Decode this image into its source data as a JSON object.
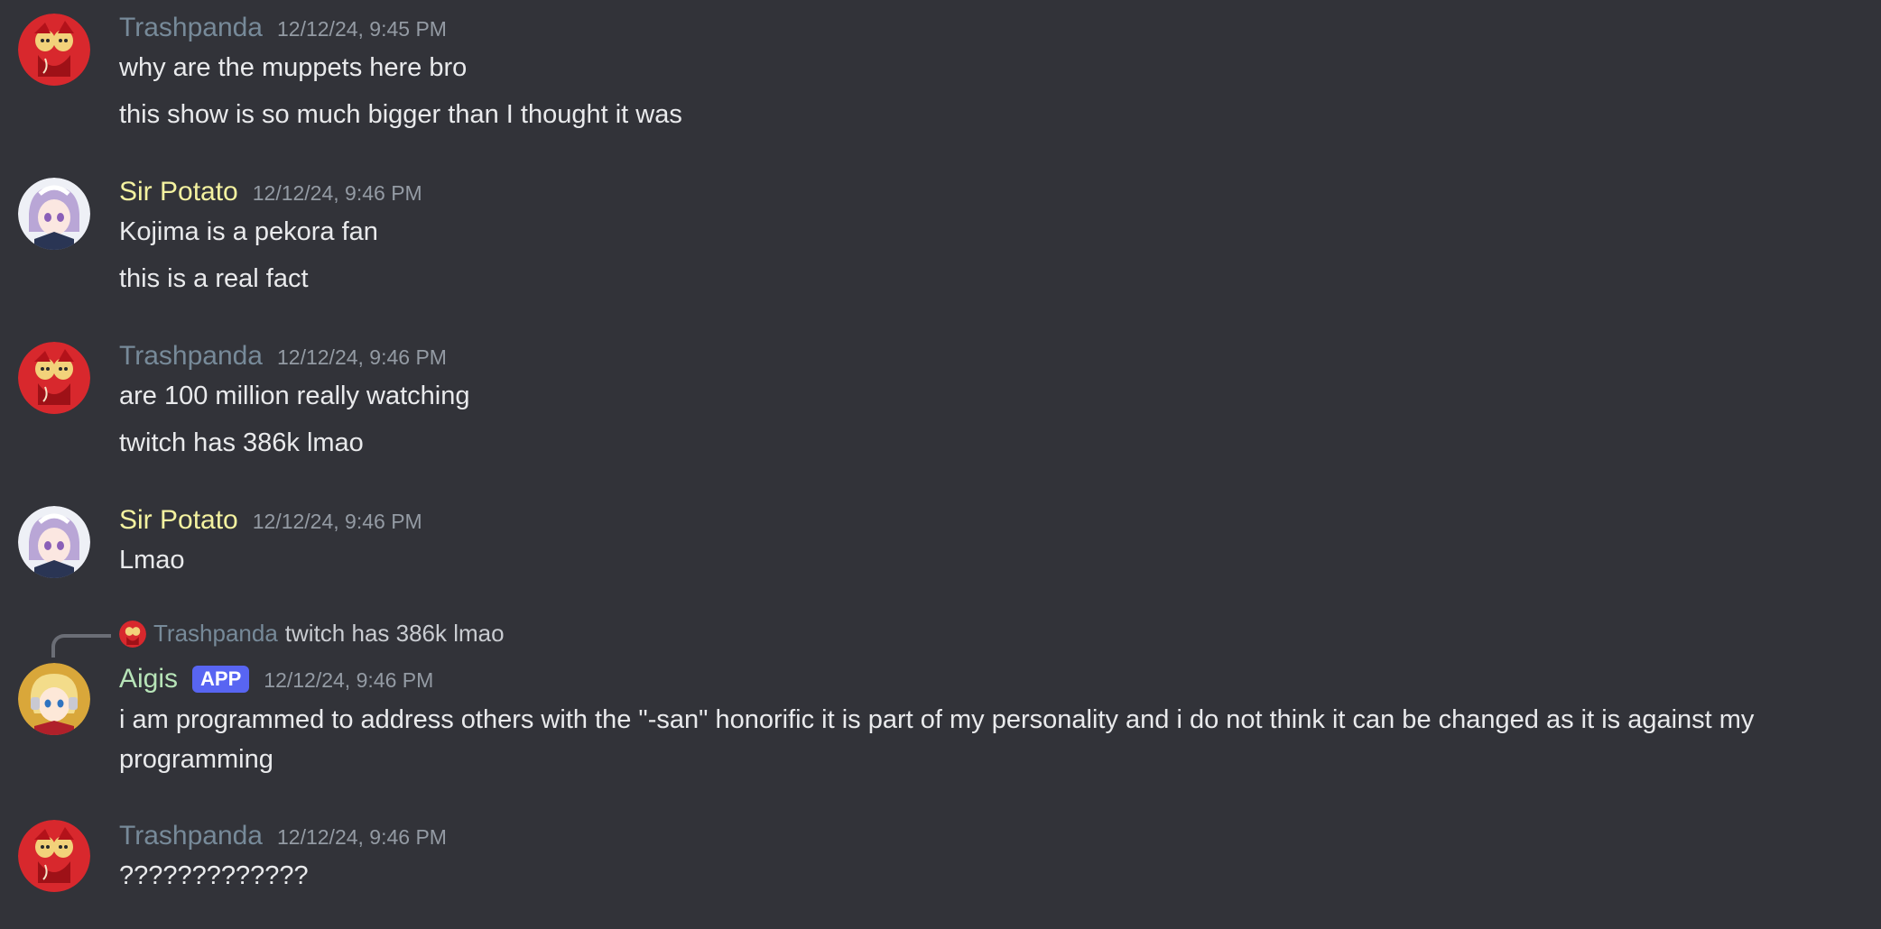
{
  "colors": {
    "background": "#323339",
    "trashpanda_name": "#778a99",
    "sir_potato_name": "#f4f2a0",
    "aigis_name": "#b7e4b8",
    "app_badge": "#5865f2",
    "timestamp": "#949ba4"
  },
  "messages": [
    {
      "author": "Trashpanda",
      "timestamp": "12/12/24, 9:45 PM",
      "avatar_icon": "trashpanda-avatar",
      "lines": [
        "why are the muppets here bro",
        "this show is so much bigger than I thought it was"
      ]
    },
    {
      "author": "Sir Potato",
      "timestamp": "12/12/24, 9:46 PM",
      "avatar_icon": "sir-potato-avatar",
      "lines": [
        "Kojima is a pekora fan",
        "this is a real fact"
      ]
    },
    {
      "author": "Trashpanda",
      "timestamp": "12/12/24, 9:46 PM",
      "avatar_icon": "trashpanda-avatar",
      "lines": [
        "are 100 million really watching",
        "twitch has 386k lmao"
      ]
    },
    {
      "author": "Sir Potato",
      "timestamp": "12/12/24, 9:46 PM",
      "avatar_icon": "sir-potato-avatar",
      "lines": [
        "Lmao"
      ]
    },
    {
      "author": "Aigis",
      "badge": "APP",
      "timestamp": "12/12/24, 9:46 PM",
      "avatar_icon": "aigis-avatar",
      "reply": {
        "author": "Trashpanda",
        "text": "twitch has 386k lmao"
      },
      "lines": [
        "i am programmed to address others with the \"-san\" honorific it is part of my personality and i do not think it can be changed as it is against my programming"
      ]
    },
    {
      "author": "Trashpanda",
      "timestamp": "12/12/24, 9:46 PM",
      "avatar_icon": "trashpanda-avatar",
      "lines": [
        "?????????????"
      ]
    }
  ]
}
